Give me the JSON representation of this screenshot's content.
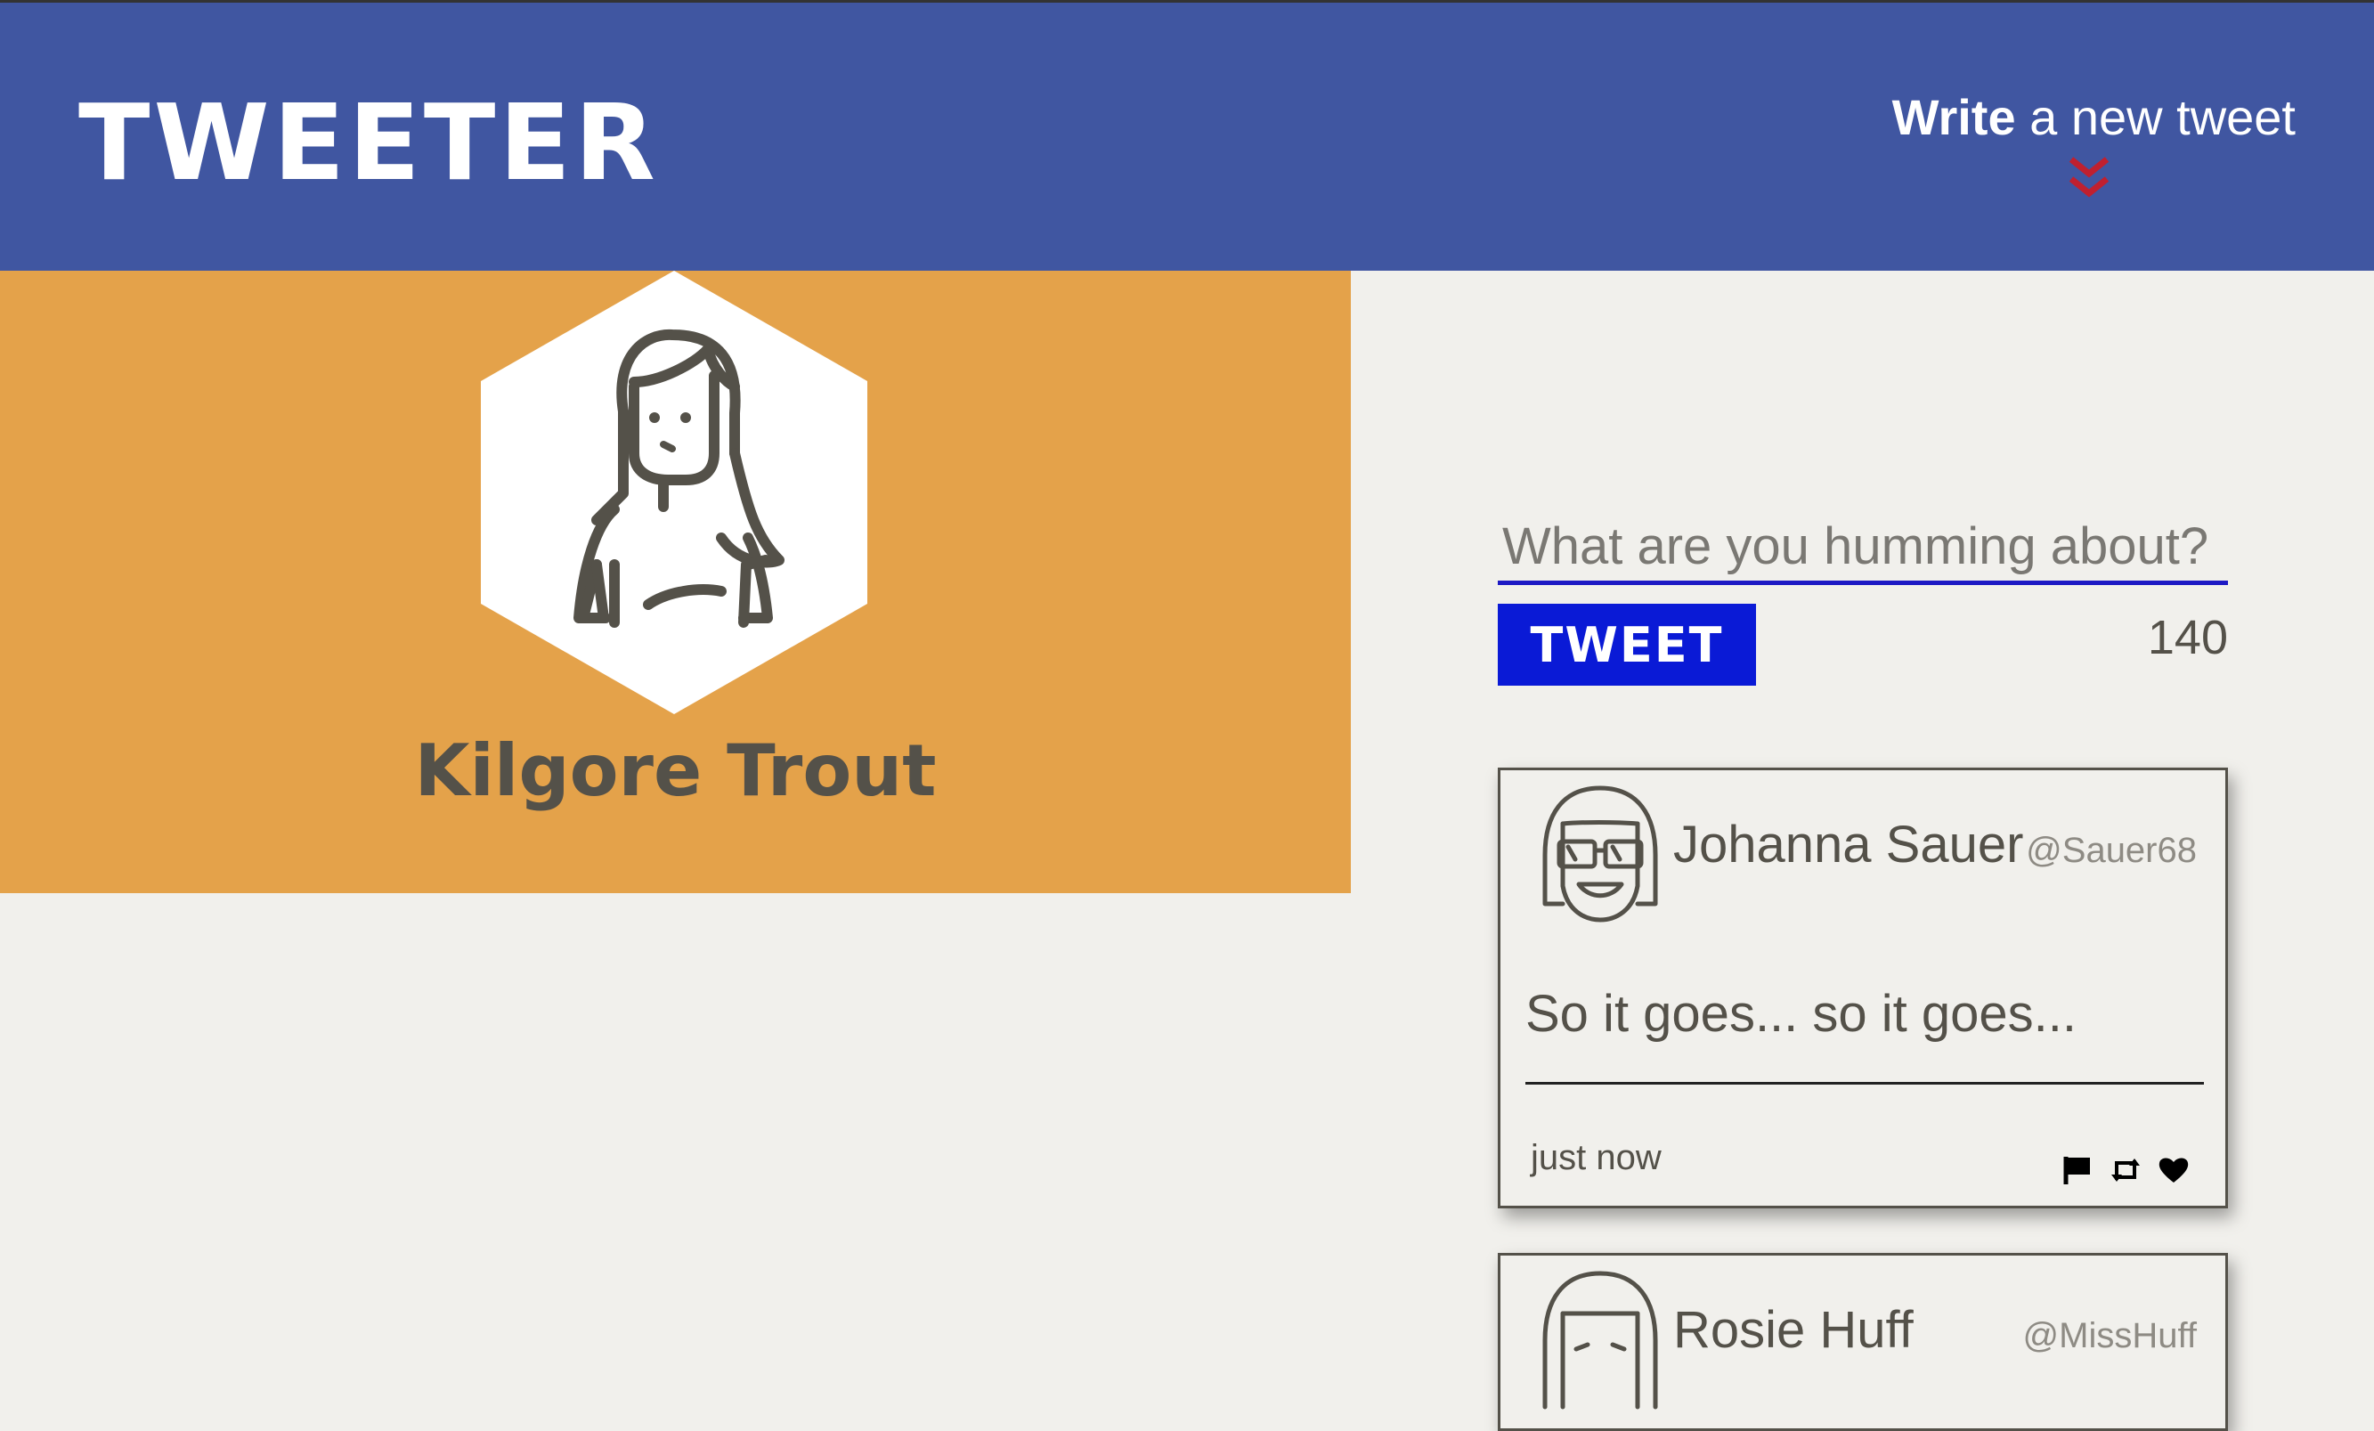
{
  "nav": {
    "logo": "TWEETER",
    "compose_bold": "Write",
    "compose_rest": " a new tweet",
    "compose_icon": "double-chevron-down-icon",
    "accent": "#c0202f",
    "background": "#4056a1"
  },
  "profile": {
    "name": "Kilgore Trout",
    "avatar_icon": "user-avatar-icon",
    "background": "#e4a24a"
  },
  "composer": {
    "placeholder": "What are you humming about?",
    "value": "",
    "button_label": "TWEET",
    "char_count": "140",
    "button_color": "#0a1ad6"
  },
  "tweets": [
    {
      "author": "Johanna Sauer",
      "handle": "@Sauer68",
      "body": "So it goes... so it goes...",
      "time": "just now",
      "actions": [
        "flag-icon",
        "retweet-icon",
        "heart-icon"
      ]
    },
    {
      "author": "Rosie Huff",
      "handle": "@MissHuff"
    }
  ]
}
